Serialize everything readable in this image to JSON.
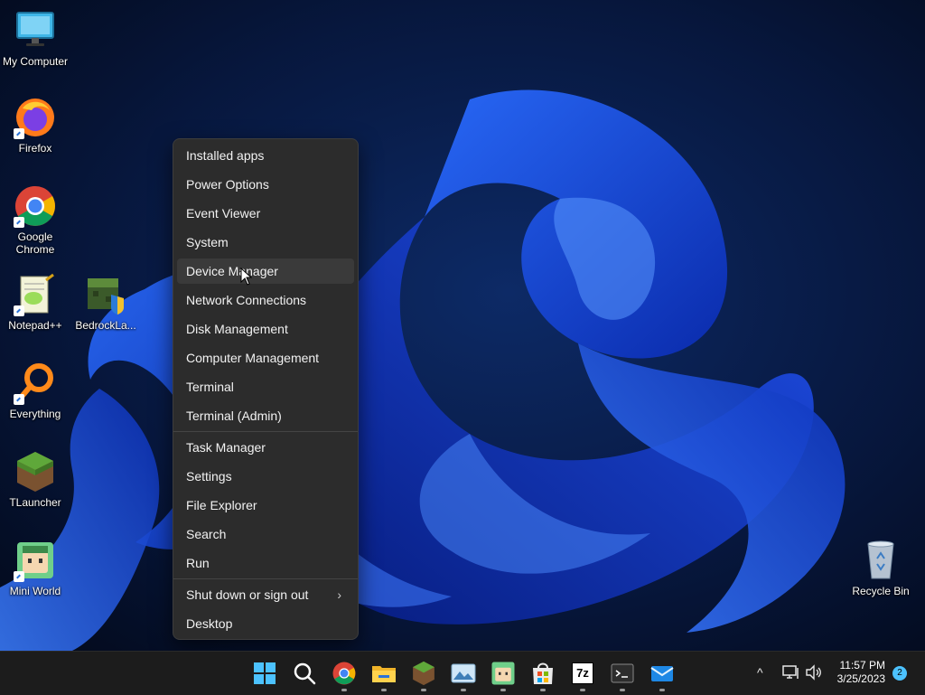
{
  "desktop": {
    "icons": [
      {
        "label": "My Computer",
        "icon": "monitor-icon"
      },
      {
        "label": "Firefox",
        "icon": "firefox-icon"
      },
      {
        "label": "Google Chrome",
        "icon": "chrome-icon"
      },
      {
        "label": "Notepad++",
        "icon": "notepadpp-icon"
      },
      {
        "label": "BedrockLa...",
        "icon": "bedrock-launcher-icon"
      },
      {
        "label": "Everything",
        "icon": "everything-search-icon"
      },
      {
        "label": "TLauncher",
        "icon": "grass-block-icon"
      },
      {
        "label": "Mini World",
        "icon": "mini-world-icon"
      },
      {
        "label": "Recycle Bin",
        "icon": "recycle-bin-icon"
      }
    ]
  },
  "context_menu": {
    "items": [
      {
        "label": "Installed apps"
      },
      {
        "label": "Power Options"
      },
      {
        "label": "Event Viewer"
      },
      {
        "label": "System"
      },
      {
        "label": "Device Manager"
      },
      {
        "label": "Network Connections"
      },
      {
        "label": "Disk Management"
      },
      {
        "label": "Computer Management"
      },
      {
        "label": "Terminal"
      },
      {
        "label": "Terminal (Admin)"
      },
      {
        "label": "Task Manager"
      },
      {
        "label": "Settings"
      },
      {
        "label": "File Explorer"
      },
      {
        "label": "Search"
      },
      {
        "label": "Run"
      },
      {
        "label": "Shut down or sign out"
      },
      {
        "label": "Desktop"
      }
    ],
    "hovered": "Device Manager",
    "submenu_glyph": "›"
  },
  "taskbar": {
    "apps": [
      {
        "name": "start",
        "icon": "windows-start-icon"
      },
      {
        "name": "search",
        "icon": "search-icon"
      },
      {
        "name": "chrome",
        "icon": "chrome-icon"
      },
      {
        "name": "file-explorer",
        "icon": "folder-icon"
      },
      {
        "name": "minecraft",
        "icon": "grass-block-icon"
      },
      {
        "name": "photos",
        "icon": "photos-icon"
      },
      {
        "name": "mini-world",
        "icon": "mini-world-icon"
      },
      {
        "name": "store",
        "icon": "store-icon"
      },
      {
        "name": "7zip",
        "icon": "7zip-icon",
        "text": "7z"
      },
      {
        "name": "terminal",
        "icon": "terminal-icon"
      },
      {
        "name": "mail",
        "icon": "mail-icon"
      }
    ],
    "tray": {
      "chevron": "^",
      "time": "11:57 PM",
      "date": "3/25/2023",
      "notification_count": "2"
    }
  },
  "colors": {
    "menu_bg": "#2c2c2c",
    "menu_hover": "#3a3a3a",
    "taskbar_bg": "#1c1c1c",
    "accent": "#4cc2ff"
  }
}
